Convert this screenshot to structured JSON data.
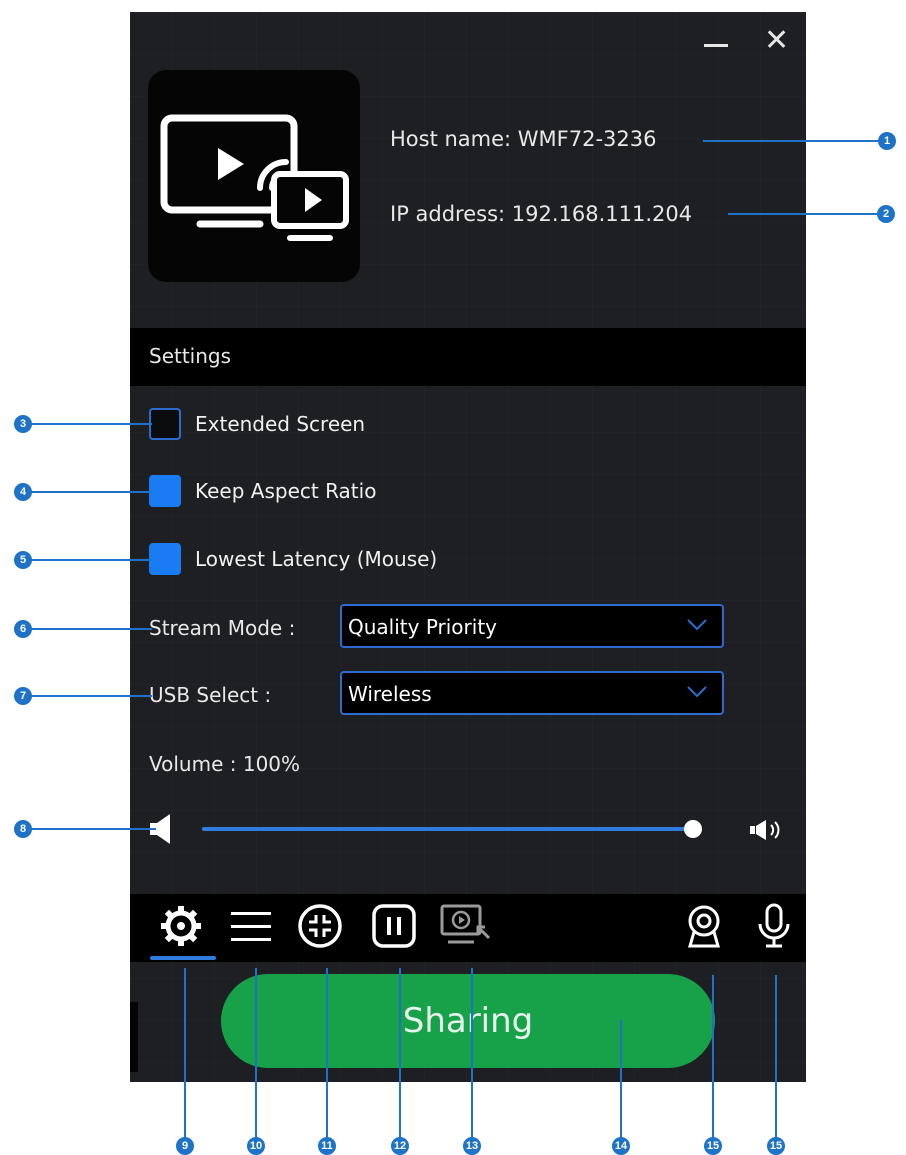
{
  "window": {
    "minimize_icon": "minimize-icon",
    "close_icon": "close-icon"
  },
  "device": {
    "host_name": "Host name: WMF72-3236",
    "ip_address": "IP address: 192.168.111.204"
  },
  "settings": {
    "header": "Settings",
    "options": [
      {
        "label": "Extended Screen",
        "checked": false
      },
      {
        "label": "Keep Aspect Ratio",
        "checked": true
      },
      {
        "label": "Lowest Latency  (Mouse)",
        "checked": true
      }
    ],
    "stream_mode": {
      "label": "Stream Mode :",
      "value": "Quality Priority"
    },
    "usb_select": {
      "label": "USB Select :",
      "value": "Wireless"
    },
    "volume": {
      "label": "Volume  : 100%",
      "level": 1.0
    }
  },
  "toolbar": {
    "items": [
      "settings-gear-icon",
      "menu-list-icon",
      "fit-screen-icon",
      "pause-icon",
      "screen-mirror-icon",
      "webcam-icon",
      "microphone-icon"
    ]
  },
  "share_button": {
    "label": "Sharing"
  },
  "callouts": [
    "1",
    "2",
    "3",
    "4",
    "5",
    "6",
    "7",
    "8",
    "9",
    "10",
    "11",
    "12",
    "13",
    "14",
    "15",
    "15"
  ],
  "colors": {
    "accent": "#2f7be0",
    "checked": "#1a7cf3",
    "share": "#17a24a",
    "callout": "#1e73c8"
  }
}
